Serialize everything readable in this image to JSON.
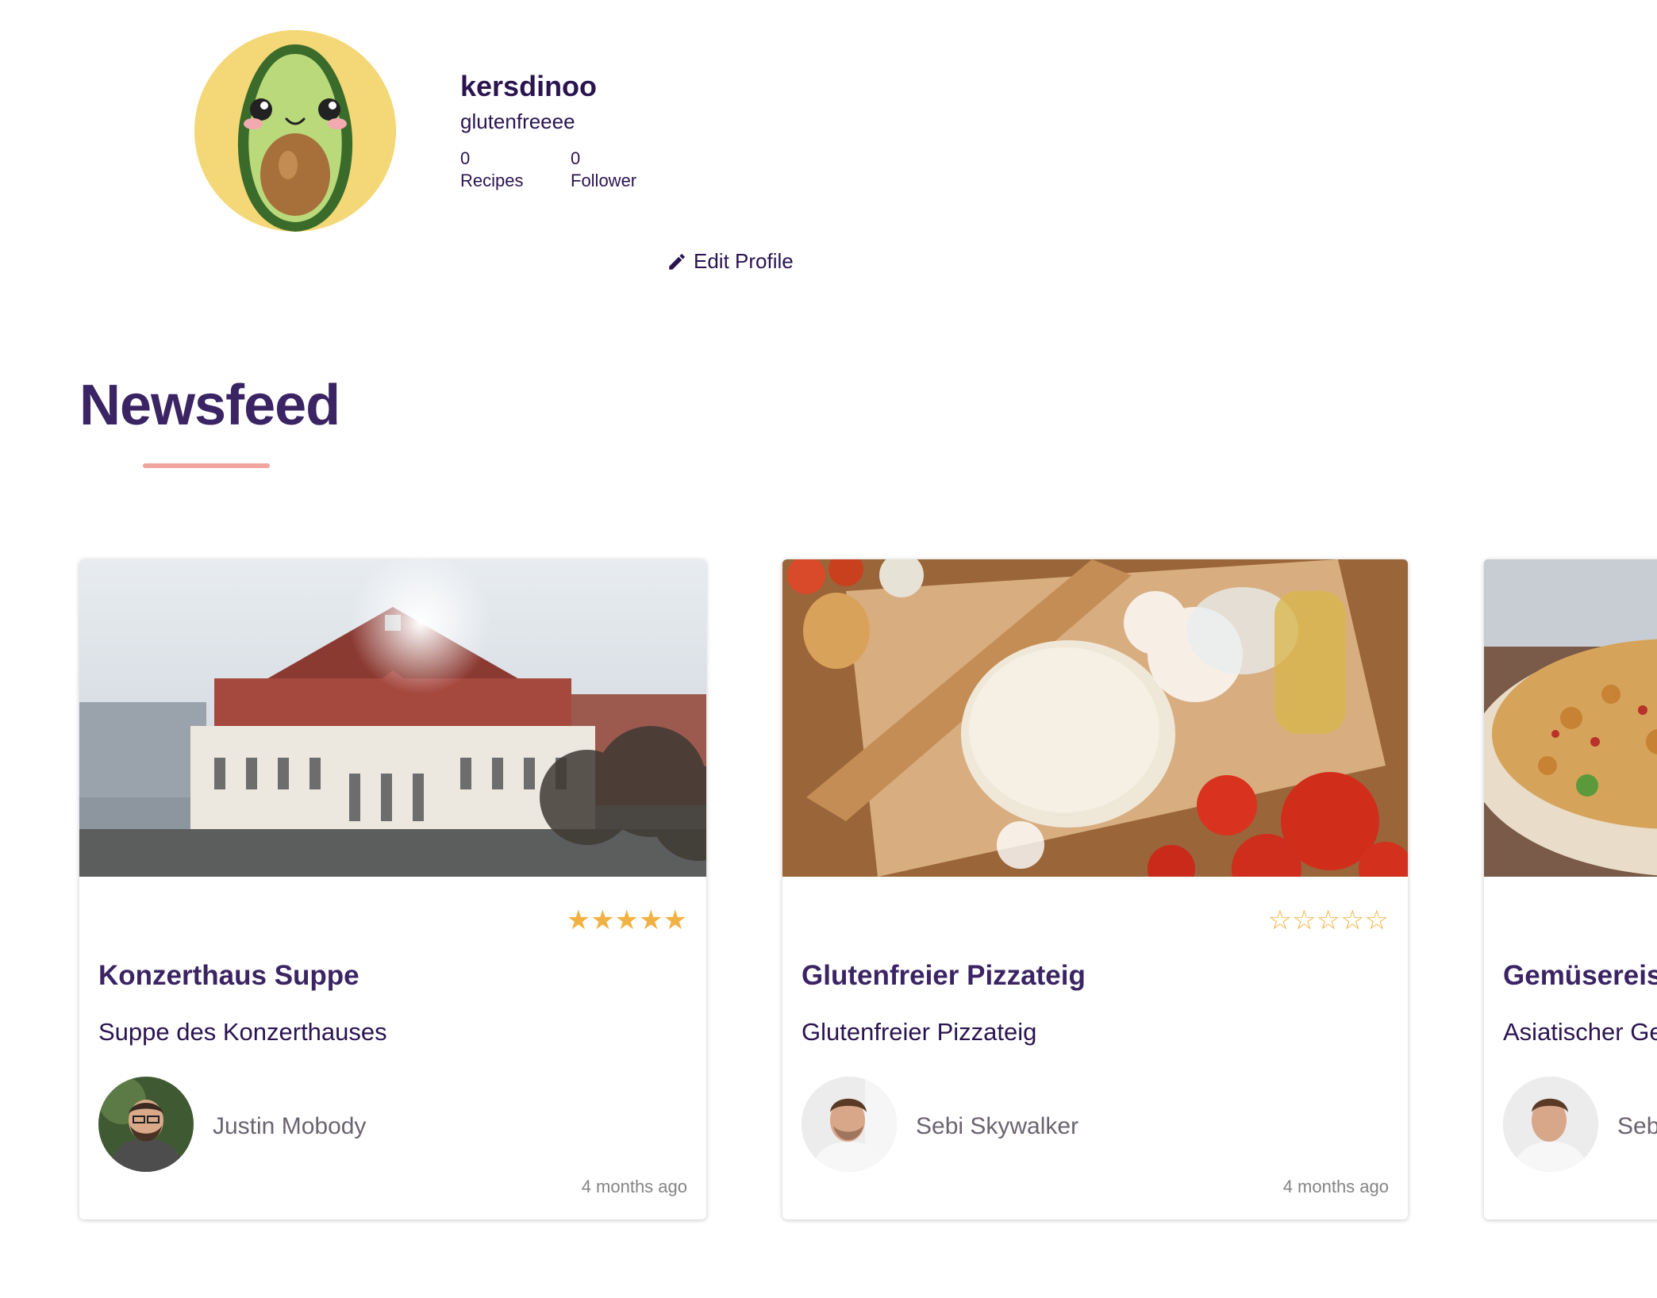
{
  "profile": {
    "username": "kersdinoo",
    "bio": "glutenfreeee",
    "stats": {
      "recipes_count": "0",
      "recipes_label": "Recipes",
      "follower_count": "0",
      "follower_label": "Follower"
    },
    "edit_label": "Edit Profile",
    "avatar_icon": "avocado-avatar-icon"
  },
  "newsfeed": {
    "title": "Newsfeed",
    "accent_color": "#f0a59e",
    "cards": [
      {
        "title": "Konzerthaus Suppe",
        "subtitle": "Suppe des Konzerthauses",
        "author": "Justin Mobody",
        "time": "4 months ago",
        "rating": "★★★★★",
        "rating_value": 5
      },
      {
        "title": "Glutenfreier Pizzateig",
        "subtitle": "Glutenfreier Pizzateig",
        "author": "Sebi Skywalker",
        "time": "4 months ago",
        "rating": "☆☆☆☆☆",
        "rating_value": 0
      },
      {
        "title": "Gemüsereis",
        "subtitle": "Asiatischer Ge",
        "author": "Sebi",
        "time": ""
      }
    ]
  },
  "colors": {
    "primary_text": "#2a1450",
    "heading": "#3b2463",
    "star": "#f2b243",
    "muted": "#848484"
  }
}
